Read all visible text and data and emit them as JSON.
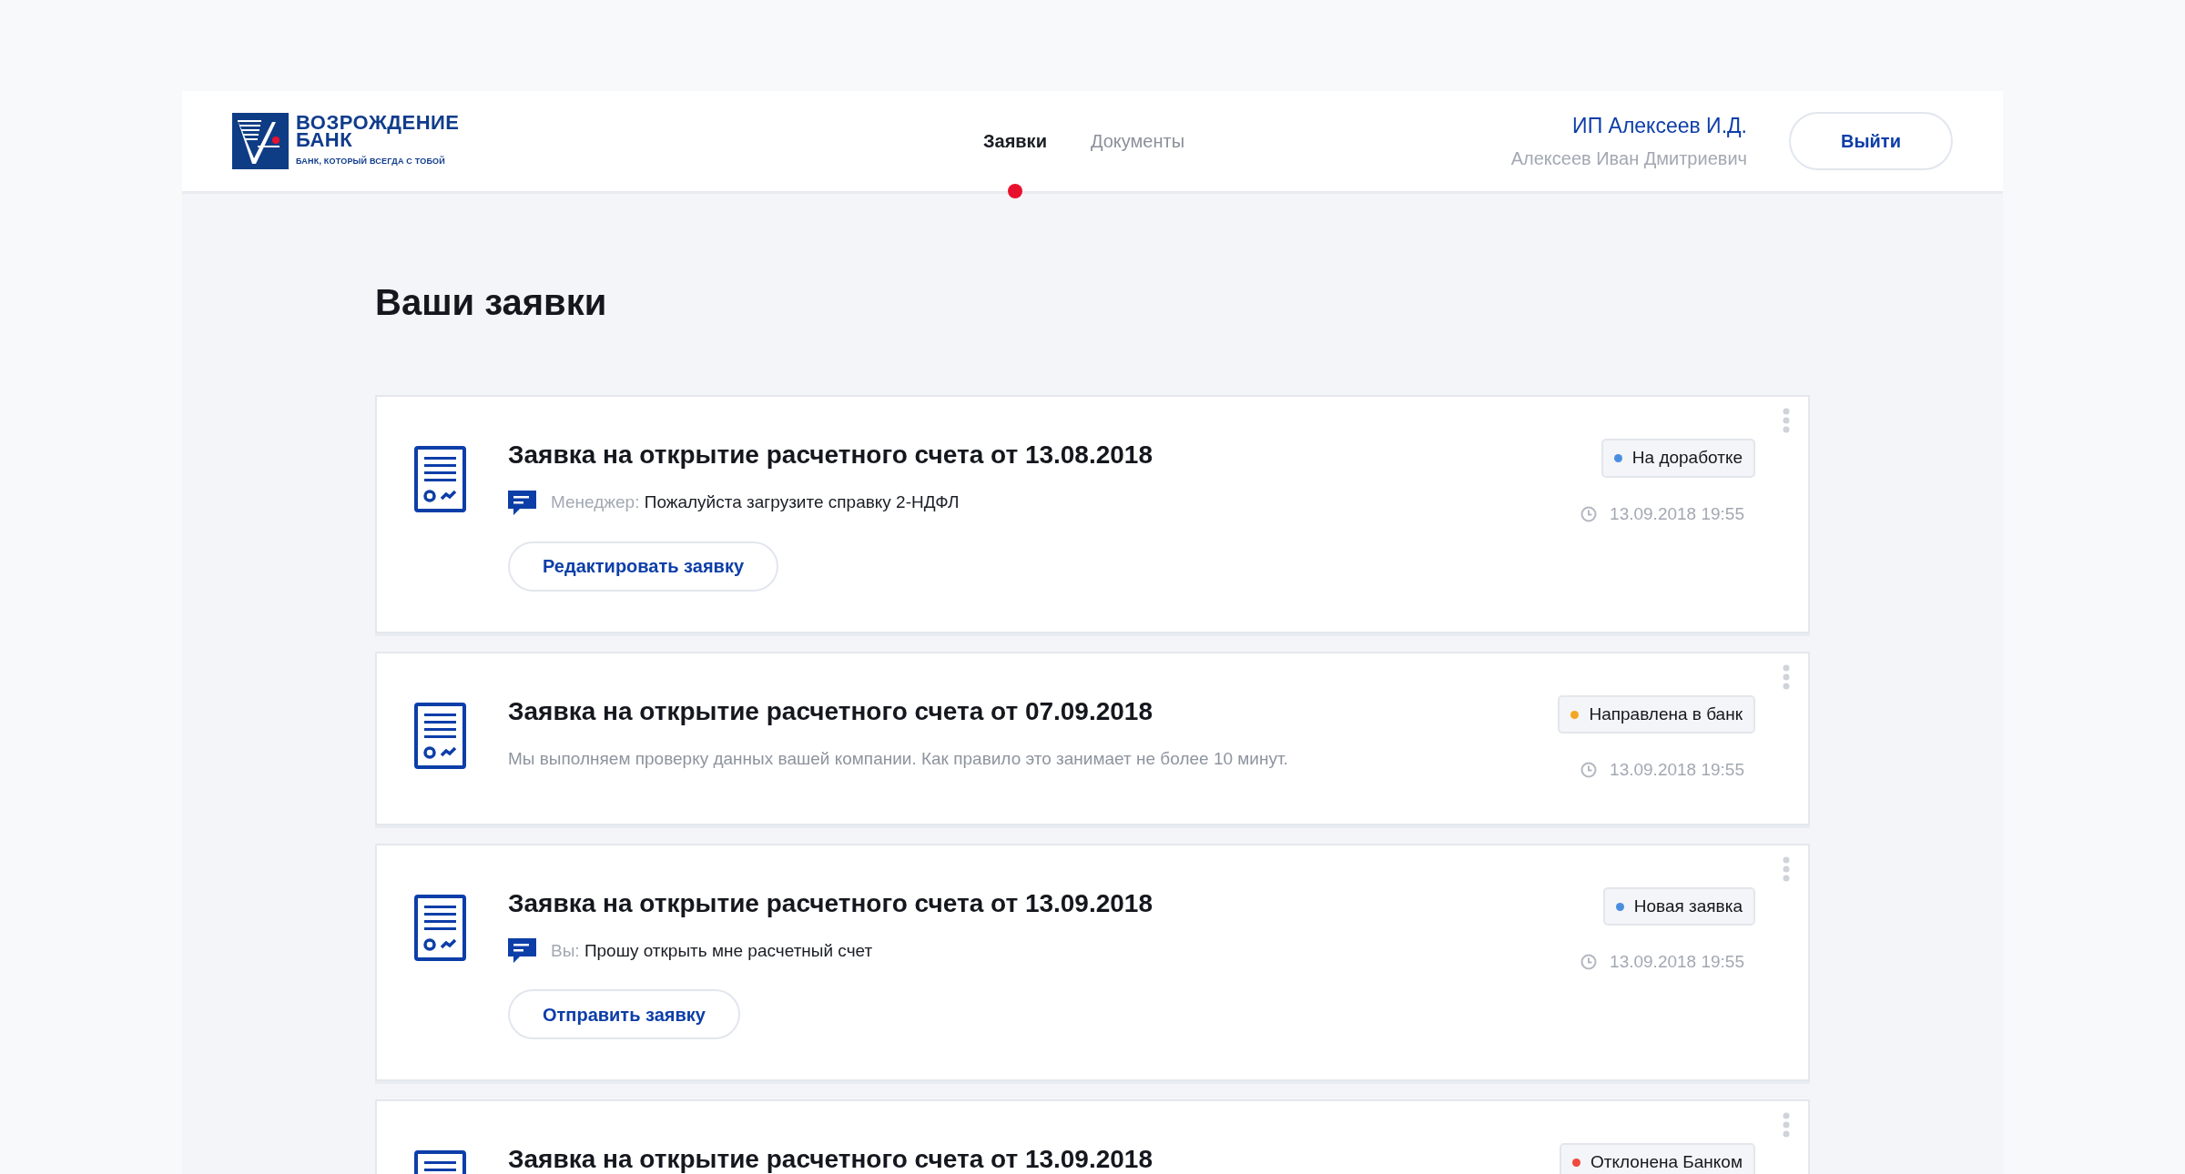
{
  "header": {
    "logo": {
      "name_line1": "ВОЗРОЖДЕНИЕ",
      "name_line2": "БАНК",
      "slogan": "БАНК, КОТОРЫЙ ВСЕГДА С ТОБОЙ"
    },
    "tabs": [
      {
        "label": "Заявки",
        "selected": true
      },
      {
        "label": "Документы",
        "selected": false
      }
    ],
    "user": {
      "company": "ИП Алексеев И.Д.",
      "name": "Алексеев Иван Дмитриевич"
    },
    "logout_button": "Выйти"
  },
  "page_title": "Ваши заявки",
  "applications": [
    {
      "title": "Заявка на открытие расчетного счета от 13.08.2018",
      "status": {
        "label": "На доработке",
        "color": "#4a8ee0"
      },
      "time": "13.09.2018 19:55",
      "message": {
        "kind": "comment",
        "author": "Менеджер:",
        "text": "Пожалуйста загрузите справку 2-НДФЛ"
      },
      "action": "Редактировать заявку"
    },
    {
      "title": "Заявка на открытие расчетного счета от 07.09.2018",
      "status": {
        "label": "Направлена в банк",
        "color": "#f5a623"
      },
      "time": "13.09.2018 19:55",
      "message": {
        "kind": "note",
        "text": "Мы выполняем проверку данных вашей компании. Как правило это занимает не более 10 минут."
      }
    },
    {
      "title": "Заявка на открытие расчетного счета от 13.09.2018",
      "status": {
        "label": "Новая заявка",
        "color": "#4a8ee0"
      },
      "time": "13.09.2018 19:55",
      "message": {
        "kind": "comment",
        "author": "Вы:",
        "text": "Прошу открыть мне расчетный счет"
      },
      "action": "Отправить заявку"
    },
    {
      "title": "Заявка на открытие расчетного счета от 13.09.2018",
      "status": {
        "label": "Отклонена Банком",
        "color": "#f0493e"
      }
    }
  ]
}
